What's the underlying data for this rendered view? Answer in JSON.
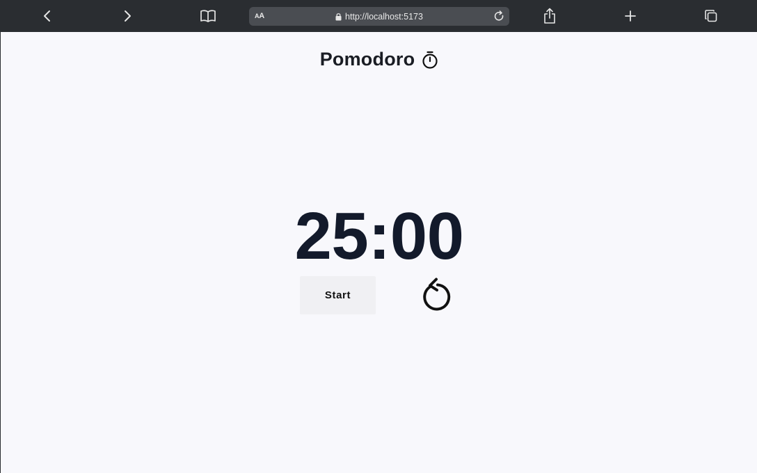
{
  "browser": {
    "url": "http://localhost:5173",
    "reader_label_big": "A",
    "reader_label_small": "A"
  },
  "app": {
    "title": "Pomodoro",
    "timer": "25:00",
    "start_label": "Start"
  },
  "icons": {
    "back": "chevron-left-icon",
    "forward": "chevron-right-icon",
    "bookmarks": "book-icon",
    "lock": "lock-icon",
    "reload": "reload-icon",
    "share": "share-icon",
    "new_tab": "plus-icon",
    "tabs": "tabs-icon",
    "stopwatch": "stopwatch-icon",
    "reset": "reset-icon"
  },
  "colors": {
    "toolbar": "#2a2d31",
    "url_bar": "#4a4d52",
    "page_bg": "#f8f8fc",
    "timer_text": "#131a2b",
    "button_bg": "#f0f0f3"
  }
}
